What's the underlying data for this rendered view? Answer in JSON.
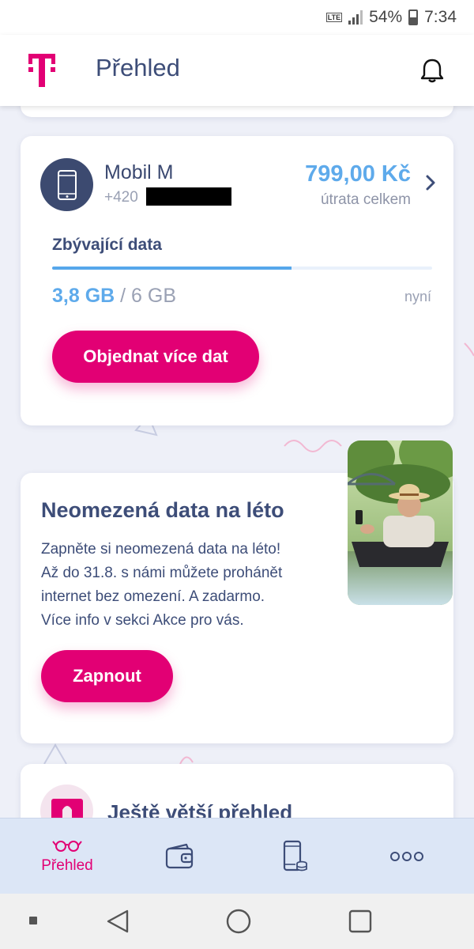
{
  "status_bar": {
    "network": "LTE",
    "battery": "54%",
    "time": "7:34"
  },
  "header": {
    "title": "Přehled",
    "logo_icon": "telekom-t-logo",
    "notification_icon": "bell-icon"
  },
  "plan_card": {
    "name": "Mobil M",
    "phone_prefix": "+420",
    "price": "799,00 Kč",
    "price_label": "útrata celkem",
    "data_label": "Zbývající data",
    "data_used": "3,8 GB",
    "data_separator": " / ",
    "data_total": "6 GB",
    "data_fraction": 0.63,
    "updated_label": "nyní",
    "button_label": "Objednat více dat"
  },
  "promo_card": {
    "title": "Neomezená data na léto",
    "lines": [
      "Zapněte si neomezená data na léto!",
      "Až do 31.8. s námi můžete prohánět",
      "internet bez omezení. A zadarmo.",
      "Více info v sekci Akce pro vás."
    ],
    "button_label": "Zapnout"
  },
  "more_card": {
    "title": "Ještě větší přehled"
  },
  "bottom_nav": {
    "items": [
      {
        "label": "Přehled",
        "icon": "glasses-icon",
        "active": true
      },
      {
        "label": "",
        "icon": "wallet-icon",
        "active": false
      },
      {
        "label": "",
        "icon": "phone-coins-icon",
        "active": false
      },
      {
        "label": "",
        "icon": "more-dots-icon",
        "active": false
      }
    ]
  },
  "colors": {
    "brand_magenta": "#e20074",
    "accent_blue": "#5eaaeb",
    "text_navy": "#3d4d78",
    "background": "#eef0f8"
  }
}
